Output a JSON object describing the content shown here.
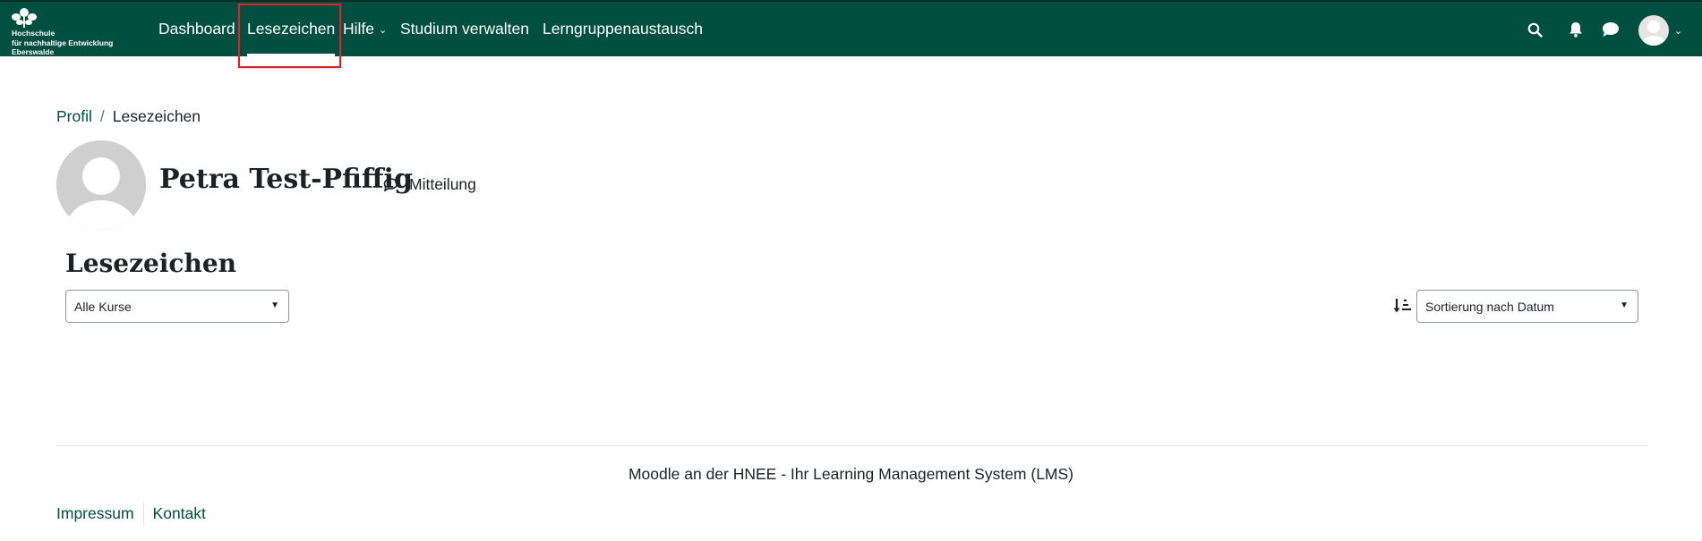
{
  "brand": {
    "logo_lines": [
      "Hochschule",
      "für nachhaltige Entwicklung",
      "Eberswalde"
    ],
    "logo_icon": "hnee-logo-mark"
  },
  "nav": {
    "items": [
      {
        "label": "Dashboard",
        "active": false
      },
      {
        "label": "Lesezeichen",
        "active": true
      },
      {
        "label": "Hilfe",
        "active": false,
        "has_dropdown": true
      },
      {
        "label": "Studium verwalten",
        "active": false
      },
      {
        "label": "Lerngruppenaustausch",
        "active": false
      }
    ],
    "icons": [
      "search-icon",
      "bell-icon",
      "chat-icon",
      "user-avatar-icon"
    ]
  },
  "breadcrumb": {
    "items": [
      "Profil",
      "Lesezeichen"
    ],
    "separator": "/"
  },
  "profile": {
    "name": "Petra Test-Pfiffig",
    "message_label": "Mitteilung"
  },
  "section": {
    "title": "Lesezeichen"
  },
  "filters": {
    "course_select": "Alle Kurse",
    "sort_select": "Sortierung nach Datum"
  },
  "footer": {
    "text": "Moodle an der HNEE - Ihr Learning Management System (LMS)",
    "links": [
      "Impressum",
      "Kontakt"
    ]
  },
  "colors": {
    "navbar": "#014f40",
    "link": "#014f40",
    "highlight": "#d9262b"
  }
}
